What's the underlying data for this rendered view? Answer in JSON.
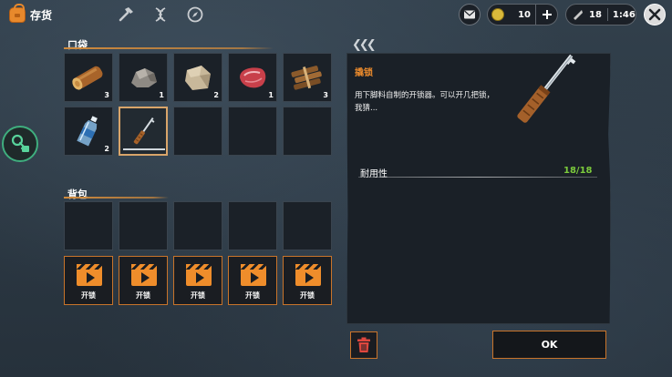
{
  "header": {
    "tab_title": "存货",
    "icons": [
      "inventory-bag-icon",
      "crafting-hammer-icon",
      "dna-icon",
      "compass-icon"
    ],
    "coins": "10",
    "ammo": "18",
    "time": "1:46"
  },
  "pocket": {
    "title": "口袋",
    "slots": [
      {
        "item": "log",
        "count": "3"
      },
      {
        "item": "stone",
        "count": "1"
      },
      {
        "item": "cloth",
        "count": "2"
      },
      {
        "item": "raw-meat",
        "count": "1"
      },
      {
        "item": "firewood-bundle",
        "count": "3"
      },
      {
        "item": "water-bottle",
        "count": "2"
      },
      {
        "item": "lockpick",
        "count": "",
        "selected": true
      },
      {
        "item": "",
        "count": ""
      },
      {
        "item": "",
        "count": ""
      },
      {
        "item": "",
        "count": ""
      }
    ]
  },
  "backpack": {
    "title": "背包",
    "unlock_label": "开锁",
    "empty_slots": 5,
    "locked_slots": 5
  },
  "detail": {
    "title": "撬锁",
    "description": "用下脚料自制的开锁器。可以开几把锁，我猜...",
    "stat_label": "耐用性",
    "stat_value": "18/18"
  },
  "buttons": {
    "ok": "OK"
  },
  "colors": {
    "accent": "#e8892c",
    "positive": "#7ccb3c",
    "side_button": "#3fae7e"
  }
}
